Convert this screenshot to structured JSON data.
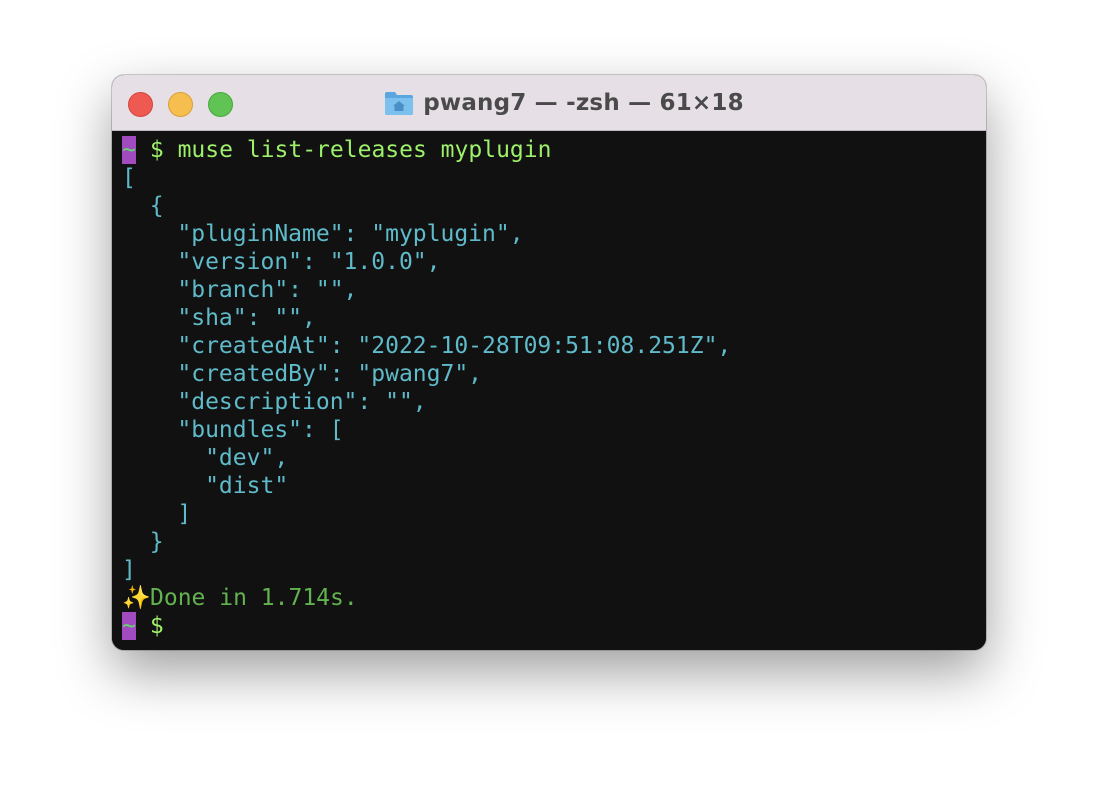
{
  "window": {
    "title": "pwang7 — -zsh — 61×18",
    "traffic_lights": [
      "close",
      "minimize",
      "zoom"
    ],
    "folder_icon": "home-folder-icon"
  },
  "colors": {
    "prompt_block": "#a04bbf",
    "prompt_tilde": "#62d96a",
    "command": "#9ef06a",
    "json_output": "#5fbac9",
    "done_text": "#62b34f",
    "terminal_bg": "#111111"
  },
  "terminal": {
    "prompt": {
      "tilde": "~",
      "dollar": "$"
    },
    "command": "muse list-releases myplugin",
    "output_lines": [
      "[",
      "  {",
      "    \"pluginName\": \"myplugin\",",
      "    \"version\": \"1.0.0\",",
      "    \"branch\": \"\",",
      "    \"sha\": \"\",",
      "    \"createdAt\": \"2022-10-28T09:51:08.251Z\",",
      "    \"createdBy\": \"pwang7\",",
      "    \"description\": \"\",",
      "    \"bundles\": [",
      "      \"dev\",",
      "      \"dist\"",
      "    ]",
      "  }",
      "]"
    ],
    "done": {
      "icon": "sparkles-icon",
      "glyph": "✨",
      "text": "Done in 1.714s."
    }
  }
}
